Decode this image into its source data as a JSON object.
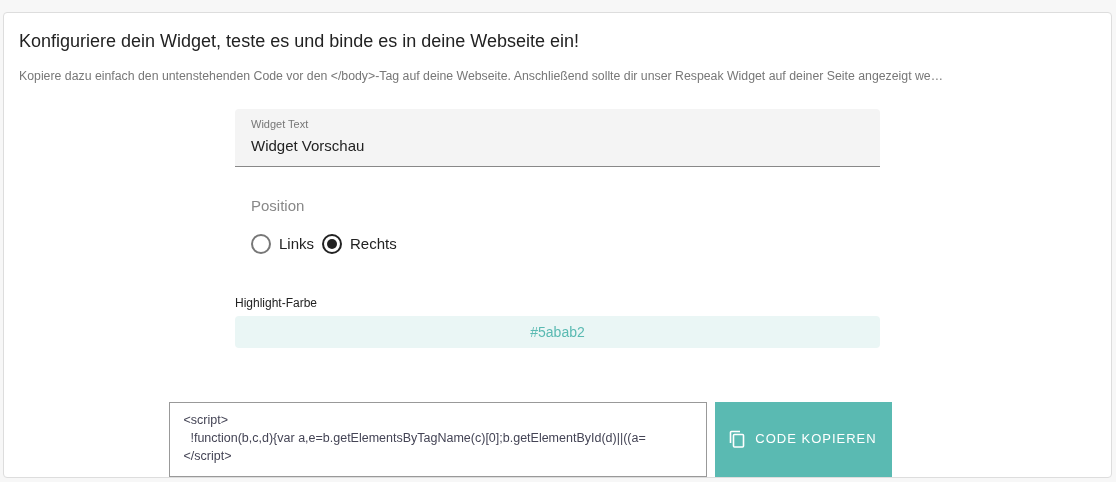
{
  "title": "Konfiguriere dein Widget, teste es und binde es in deine Webseite ein!",
  "subtitle": "Kopiere dazu einfach den untenstehenden Code vor den </body>-Tag auf deine Webseite. Anschließend sollte dir unser Respeak Widget auf deiner Seite angezeigt we…",
  "widget_text": {
    "label": "Widget Text",
    "value": "Widget Vorschau"
  },
  "position": {
    "label": "Position",
    "options": [
      {
        "label": "Links",
        "selected": false
      },
      {
        "label": "Rechts",
        "selected": true
      }
    ]
  },
  "highlight": {
    "label": "Highlight-Farbe",
    "value": "#5abab2"
  },
  "code": [
    "<script>",
    "  !function(b,c,d){var a,e=b.getElementsByTagName(c)[0];b.getElementById(d)||((a=",
    "</script>"
  ],
  "copy_button": {
    "label": "CODE KOPIEREN"
  }
}
